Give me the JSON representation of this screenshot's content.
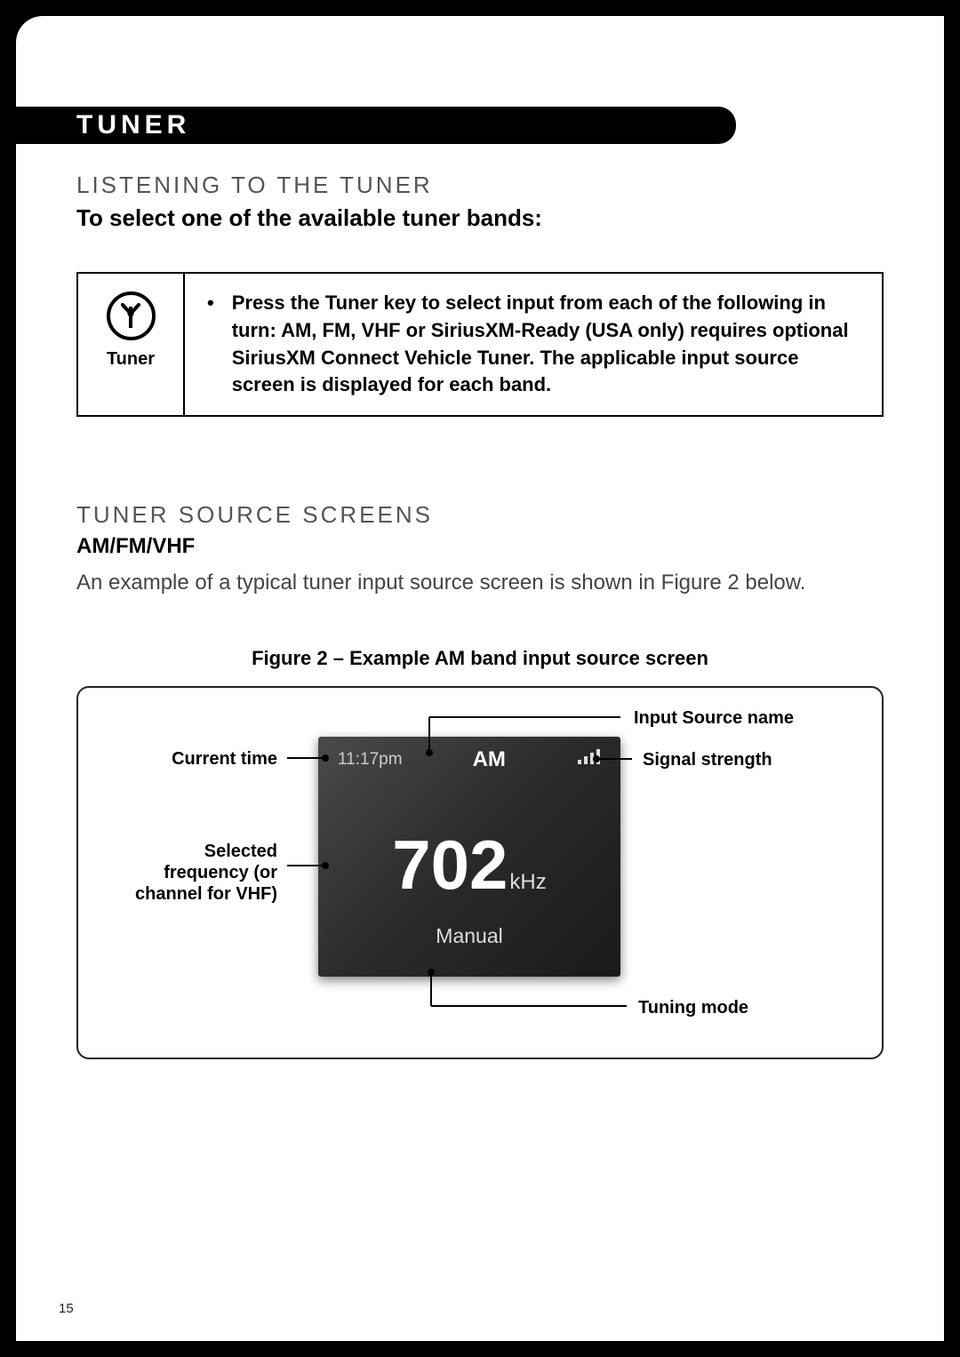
{
  "header": {
    "title": "TUNER"
  },
  "section1": {
    "subtitle": "LISTENING TO THE TUNER",
    "heading": "To select one of the available tuner bands:"
  },
  "info_table": {
    "icon_label": "Tuner",
    "bullet_text": "Press the Tuner key to select input from each of the following in turn: AM, FM, VHF or SiriusXM-Ready (USA only) requires optional SiriusXM Connect Vehicle Tuner. The applicable input source screen is displayed for each band."
  },
  "section2": {
    "subtitle": "TUNER SOURCE SCREENS",
    "heading": "AM/FM/VHF",
    "body": "An example of a typical tuner input source screen is shown in Figure 2 below."
  },
  "figure": {
    "caption": "Figure 2 – Example AM band input source screen",
    "screen": {
      "time": "11:17pm",
      "band": "AM",
      "frequency": "702",
      "frequency_unit": "kHz",
      "mode": "Manual"
    },
    "callouts": {
      "input_source": "Input Source name",
      "current_time": "Current time",
      "signal_strength": "Signal strength",
      "selected_freq_l1": "Selected",
      "selected_freq_l2": "frequency (or",
      "selected_freq_l3": "channel for VHF)",
      "tuning_mode": "Tuning mode"
    }
  },
  "page_number": "15"
}
